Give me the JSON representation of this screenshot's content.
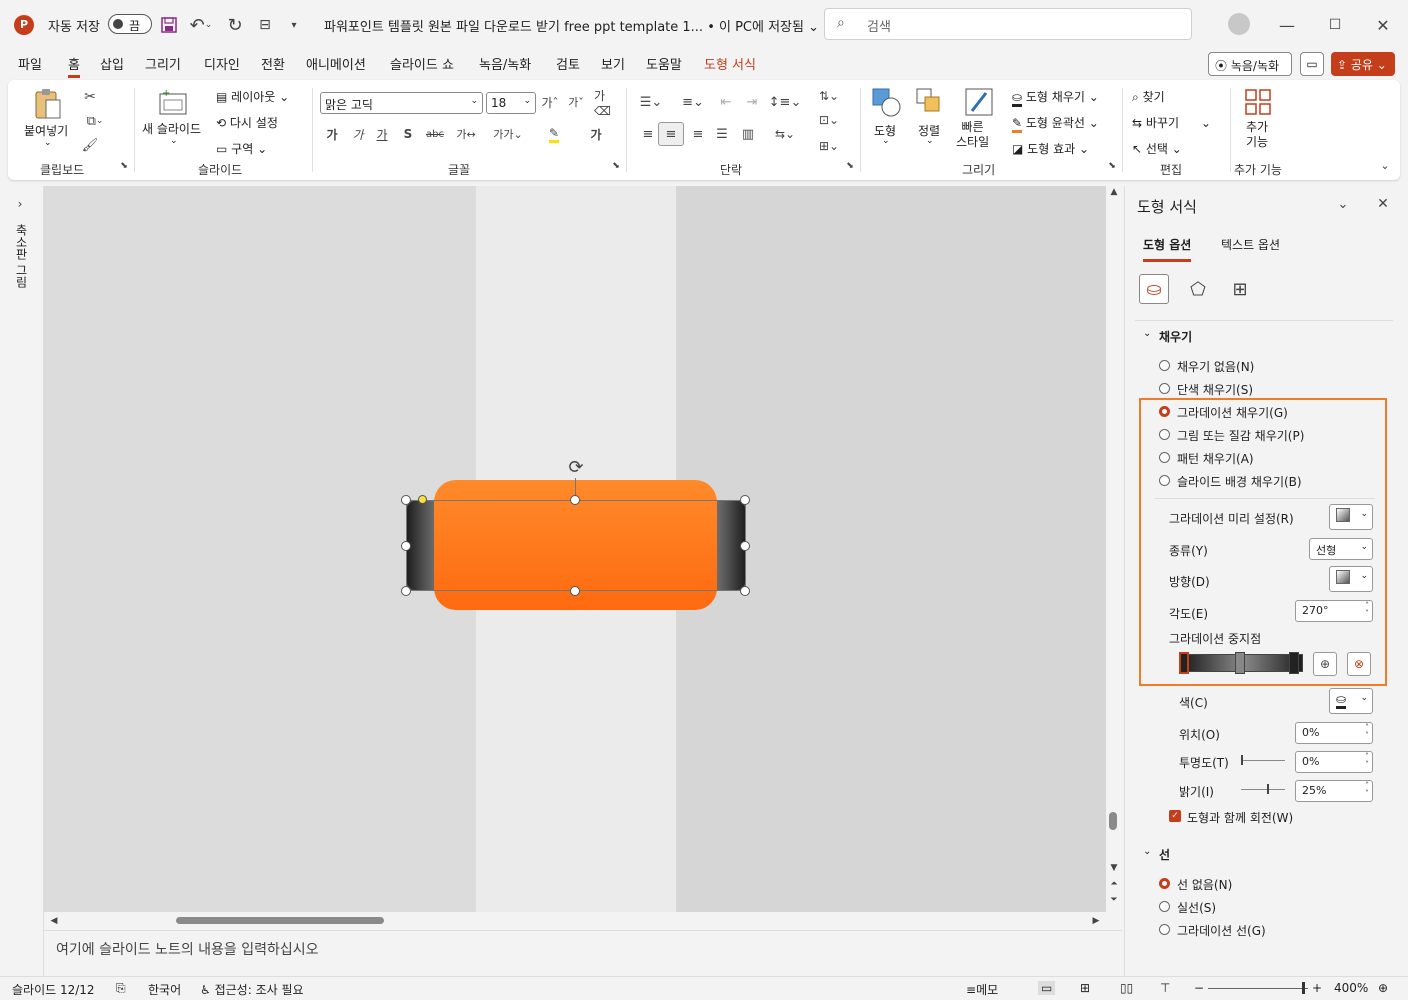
{
  "titlebar": {
    "autosave_label": "자동 저장",
    "autosave_state": "끔",
    "doc_title": "파워포인트 템플릿 원본 파일 다운로드 받기 free ppt template 1... • 이 PC에 저장됨",
    "search_placeholder": "검색",
    "app_icon": "powerpoint-icon"
  },
  "menu": {
    "items": [
      "파일",
      "홈",
      "삽입",
      "그리기",
      "디자인",
      "전환",
      "애니메이션",
      "슬라이드 쇼",
      "녹음/녹화",
      "검토",
      "보기",
      "도움말",
      "도형 서식"
    ],
    "record_button": "녹음/녹화",
    "share_button": "공유"
  },
  "ribbon": {
    "clipboard": {
      "paste": "붙여넣기",
      "label": "클립보드"
    },
    "slides": {
      "new_slide": "새 슬라이드",
      "layout": "레이아웃",
      "reset": "다시 설정",
      "section": "구역",
      "label": "슬라이드"
    },
    "font": {
      "font_name": "맑은 고딕",
      "font_size": "18",
      "label": "글꼴",
      "bold": "가",
      "italic": "가",
      "underline": "가",
      "shadow": "S"
    },
    "paragraph": {
      "label": "단락"
    },
    "drawing": {
      "shapes": "도형",
      "arrange": "정렬",
      "quick_styles": "빠른\n스타일",
      "fill": "도형 채우기",
      "outline": "도형 윤곽선",
      "effects": "도형 효과",
      "label": "그리기"
    },
    "editing": {
      "find": "찾기",
      "replace": "바꾸기",
      "select": "선택",
      "label": "편집"
    },
    "addins": {
      "addins": "추가\n기능",
      "label": "추가 기능"
    }
  },
  "leftpanel": {
    "thumbnail_label": "축소판 그림"
  },
  "notes": {
    "placeholder": "여기에 슬라이드 노트의 내용을 입력하십시오"
  },
  "status": {
    "slide": "슬라이드 12/12",
    "language": "한국어",
    "accessibility": "접근성: 조사 필요",
    "notes": "메모",
    "zoom": "400%"
  },
  "pane": {
    "title": "도형 서식",
    "tabs": [
      "도형 옵션",
      "텍스트 옵션"
    ],
    "fill_section": "채우기",
    "fill_options": [
      {
        "label": "채우기 없음(N)",
        "selected": false
      },
      {
        "label": "단색 채우기(S)",
        "selected": false
      },
      {
        "label": "그라데이션 채우기(G)",
        "selected": true
      },
      {
        "label": "그림 또는 질감 채우기(P)",
        "selected": false
      },
      {
        "label": "패턴 채우기(A)",
        "selected": false
      },
      {
        "label": "슬라이드 배경 채우기(B)",
        "selected": false
      }
    ],
    "preset_label": "그라데이션 미리 설정(R)",
    "type_label": "종류(Y)",
    "type_value": "선형",
    "direction_label": "방향(D)",
    "angle_label": "각도(E)",
    "angle_value": "270°",
    "stops_label": "그라데이션 중지점",
    "color_label": "색(C)",
    "position_label": "위치(O)",
    "position_value": "0%",
    "transparency_label": "투명도(T)",
    "transparency_value": "0%",
    "brightness_label": "밝기(I)",
    "brightness_value": "25%",
    "rotate_label": "도형과 함께 회전(W)",
    "rotate_checked": true,
    "line_section": "선",
    "line_options": [
      {
        "label": "선 없음(N)",
        "selected": true
      },
      {
        "label": "실선(S)",
        "selected": false
      },
      {
        "label": "그라데이션 선(G)",
        "selected": false
      }
    ]
  },
  "colors": {
    "accent": "#c43e1c",
    "orange_shape": "#ff7a1a",
    "highlight_box": "#f07c2a"
  }
}
